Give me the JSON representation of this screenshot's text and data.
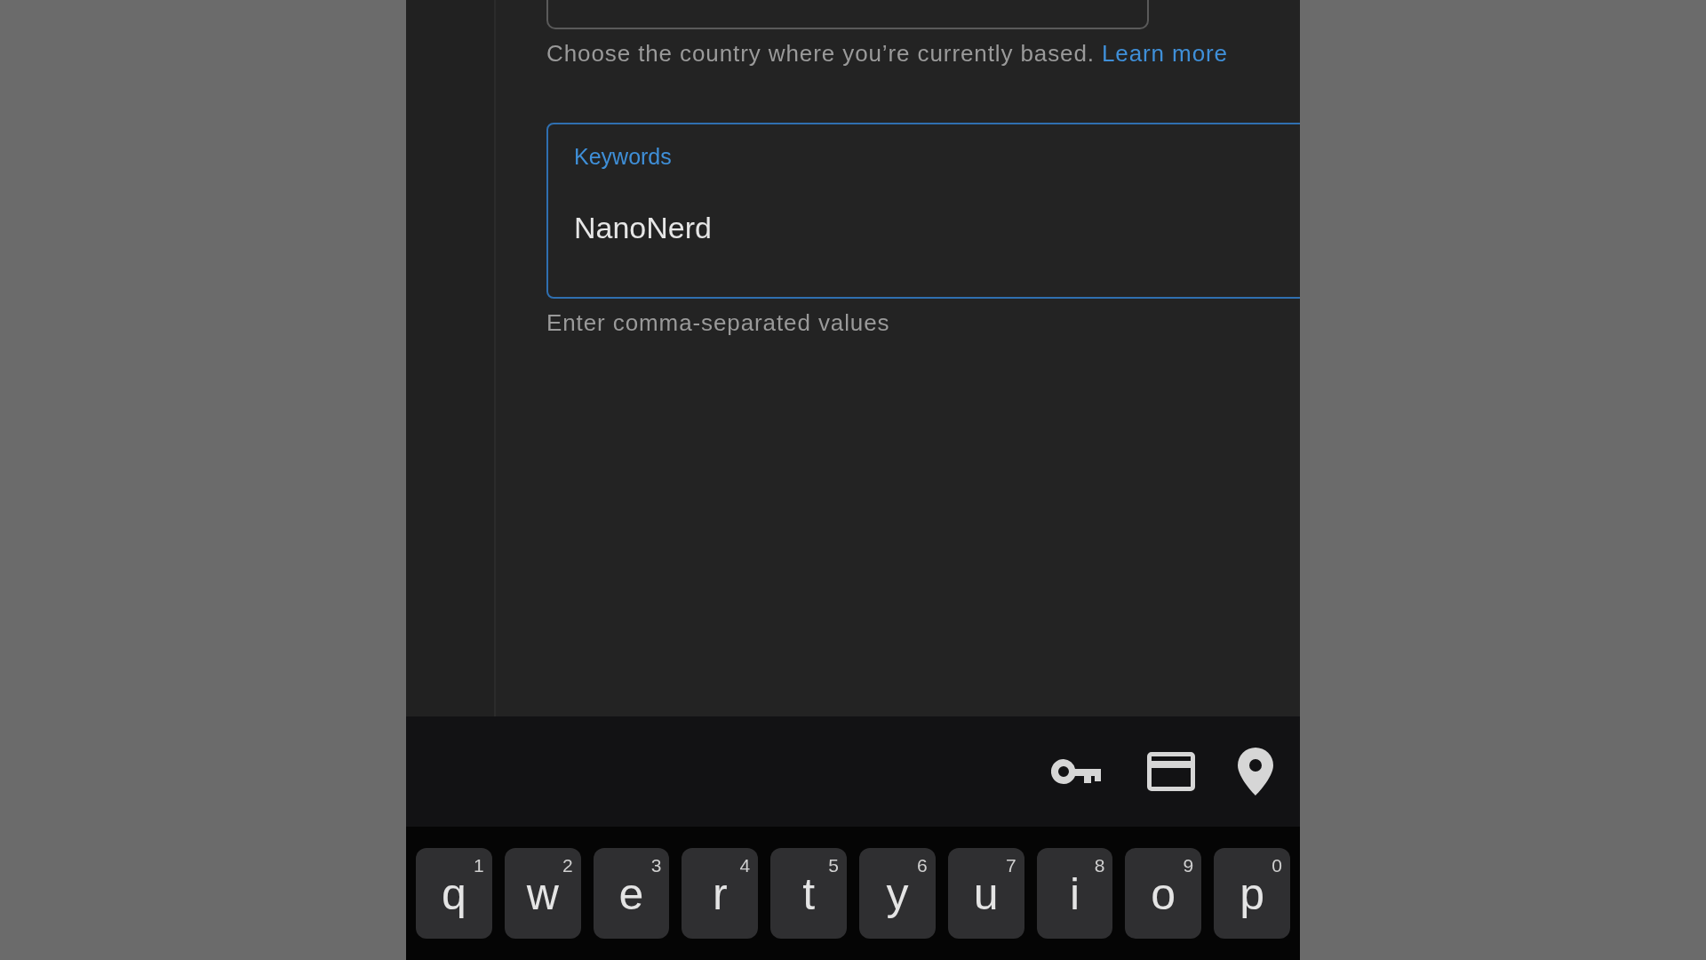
{
  "country_field": {
    "helper": "Choose the country where you’re currently based.",
    "link": "Learn more"
  },
  "keywords_field": {
    "label": "Keywords",
    "value": "NanoNerd",
    "focused": true,
    "helper": "Enter comma-separated values"
  },
  "keyboard": {
    "keys": [
      {
        "label": "q",
        "hint": "1"
      },
      {
        "label": "w",
        "hint": "2"
      },
      {
        "label": "e",
        "hint": "3"
      },
      {
        "label": "r",
        "hint": "4"
      },
      {
        "label": "t",
        "hint": "5"
      },
      {
        "label": "y",
        "hint": "6"
      },
      {
        "label": "u",
        "hint": "7"
      },
      {
        "label": "i",
        "hint": "8"
      },
      {
        "label": "o",
        "hint": "9"
      },
      {
        "label": "p",
        "hint": "0"
      }
    ]
  }
}
